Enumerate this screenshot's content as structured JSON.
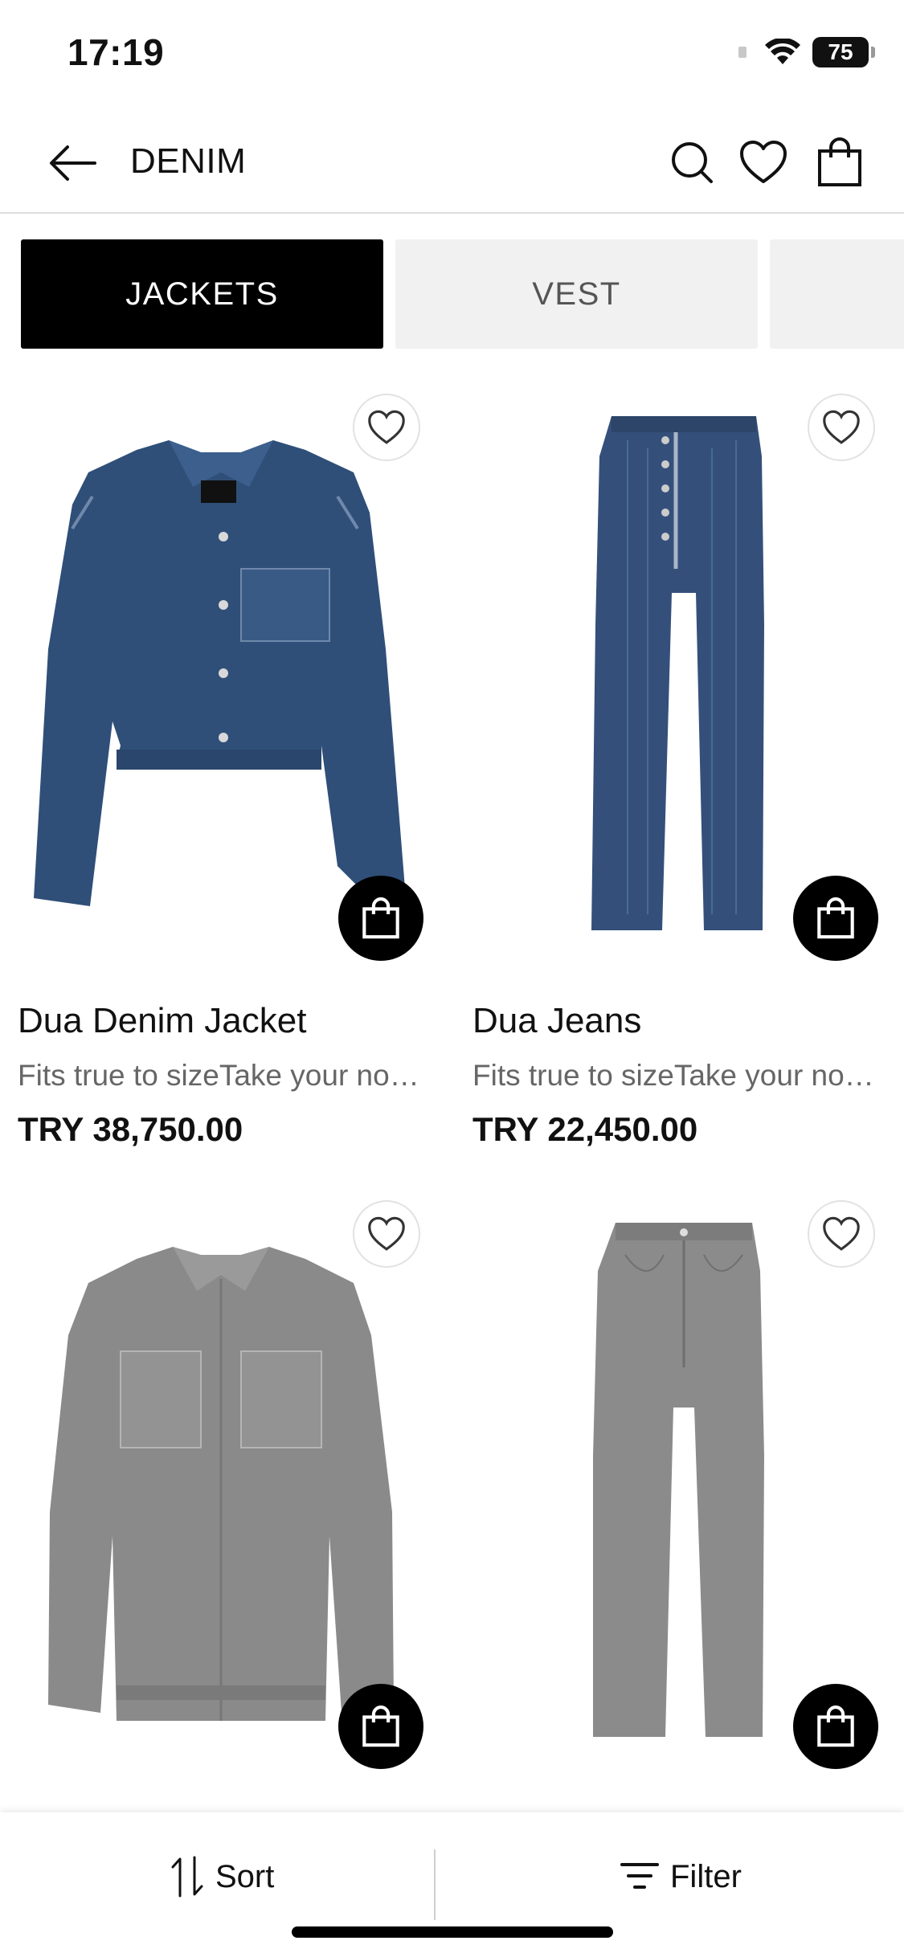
{
  "status_bar": {
    "time": "17:19",
    "battery": "75"
  },
  "header": {
    "title": "DENIM",
    "icons": [
      "back-arrow-icon",
      "search-icon",
      "heart-icon",
      "shopping-bag-icon"
    ]
  },
  "tabs": [
    {
      "label": "JACKETS",
      "active": true
    },
    {
      "label": "VEST",
      "active": false
    },
    {
      "label": "",
      "active": false
    }
  ],
  "products": [
    {
      "name": "Dua Denim Jacket",
      "description": "Fits true to sizeTake your normal size",
      "price": "TRY 38,750.00",
      "image": "blue-denim-jacket",
      "color": "#2f4f78"
    },
    {
      "name": "Dua Jeans",
      "description": "Fits true to sizeTake your normal size",
      "price": "TRY 22,450.00",
      "image": "blue-denim-jeans",
      "color": "#34507a"
    },
    {
      "name": "",
      "description": "",
      "price": "",
      "image": "grey-denim-shirt",
      "color": "#8a8a8a"
    },
    {
      "name": "",
      "description": "",
      "price": "",
      "image": "grey-denim-jeans",
      "color": "#8b8b8b"
    }
  ],
  "bottom_bar": {
    "sort_label": "Sort",
    "filter_label": "Filter"
  },
  "colors": {
    "accent": "#000000",
    "tab_inactive_bg": "#f1f1f1",
    "muted_text": "#666666"
  }
}
